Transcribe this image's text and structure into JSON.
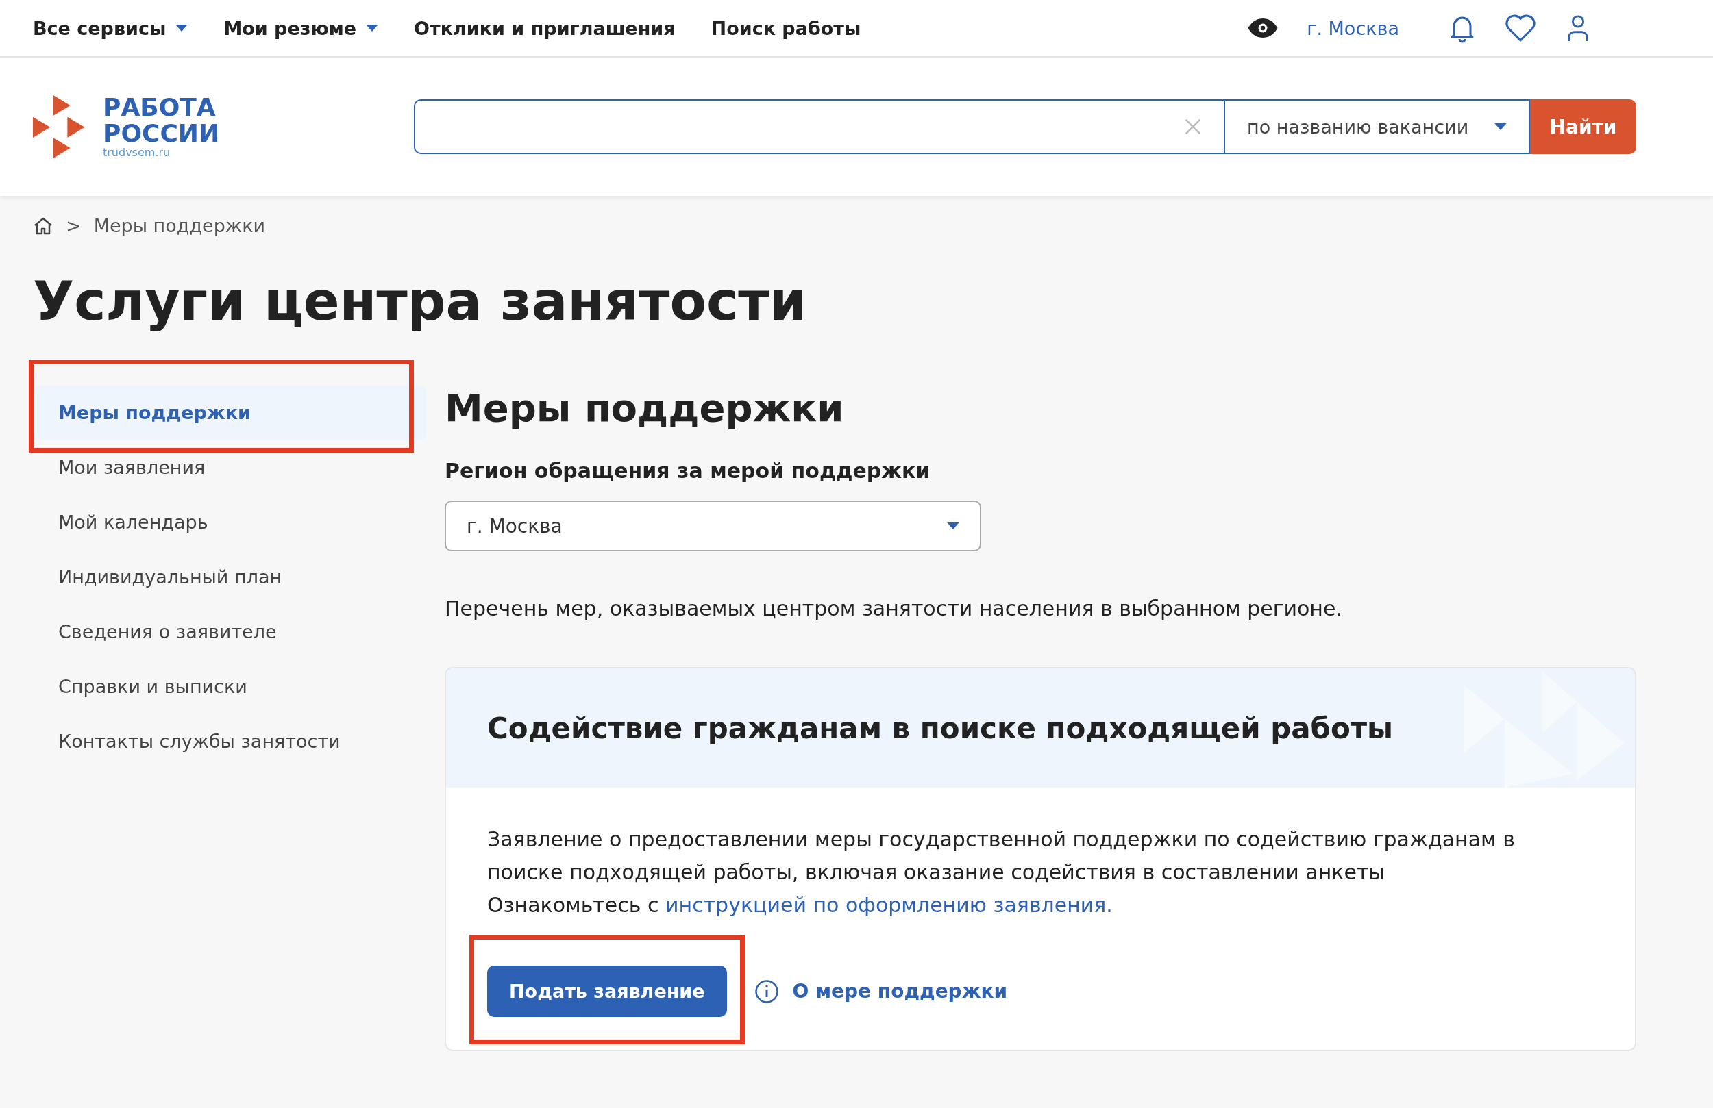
{
  "top_nav": {
    "items": [
      {
        "label": "Все сервисы",
        "dropdown": true
      },
      {
        "label": "Мои резюме",
        "dropdown": true
      },
      {
        "label": "Отклики и приглашения",
        "dropdown": false
      },
      {
        "label": "Поиск работы",
        "dropdown": false
      }
    ],
    "city": "г. Москва"
  },
  "header": {
    "logo": {
      "line1": "РАБОТА",
      "line2": "РОССИИ",
      "domain": "trudvsem.ru"
    },
    "search": {
      "mode": "по названию вакансии",
      "button": "Найти"
    }
  },
  "breadcrumb": {
    "separator": ">",
    "current": "Меры поддержки"
  },
  "page_title": "Услуги центра занятости",
  "sidebar": {
    "items": [
      {
        "label": "Меры поддержки",
        "selected": true
      },
      {
        "label": "Мои заявления",
        "selected": false
      },
      {
        "label": "Мой календарь",
        "selected": false
      },
      {
        "label": "Индивидуальный план",
        "selected": false
      },
      {
        "label": "Сведения о заявителе",
        "selected": false
      },
      {
        "label": "Справки и выписки",
        "selected": false
      },
      {
        "label": "Контакты службы занятости",
        "selected": false
      }
    ]
  },
  "main": {
    "title": "Меры поддержки",
    "region_label": "Регион обращения за мерой поддержки",
    "region_value": "г. Москва",
    "intro": "Перечень мер, оказываемых центром занятости населения в выбранном регионе.",
    "cards": [
      {
        "title": "Содействие гражданам в поиске подходящей работы",
        "description": "Заявление о предоставлении меры государственной поддержки по содействию гражданам в поиске подходящей работы, включая оказание содействия в составлении анкеты",
        "instruction_prefix": "Ознакомьтесь с ",
        "instruction_link": "инструкцией по оформлению заявления.",
        "apply_button": "Подать заявление",
        "info_link": "О мере поддержки"
      }
    ]
  }
}
